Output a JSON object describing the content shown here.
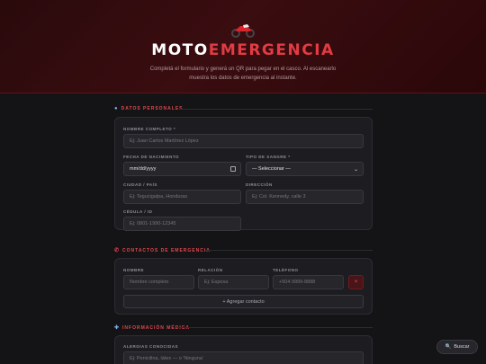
{
  "hero": {
    "icon": "motorcycle-icon",
    "title_white": "MOTO",
    "title_red": "EMERGENCIA",
    "subtitle": "Completá el formulario y generá un QR para pegar en el casco. Al escanearlo muestra los datos de emergencia al instante."
  },
  "sections": {
    "personal": {
      "icon": "person-icon",
      "label": "DATOS PERSONALES"
    },
    "contacts": {
      "icon": "phone-icon",
      "label": "CONTACTOS DE EMERGENCIA"
    },
    "medical": {
      "icon": "medical-icon",
      "label": "INFORMACIÓN MÉDICA"
    }
  },
  "personal": {
    "name_label": "NOMBRE COMPLETO *",
    "name_placeholder": "Ej: Juan Carlos Martínez López",
    "dob_label": "FECHA DE NACIMIENTO",
    "dob_value": "mm/dd/yyyy",
    "blood_label": "TIPO DE SANGRE *",
    "blood_value": "— Seleccionar —",
    "city_label": "CIUDAD / PAÍS",
    "city_placeholder": "Ej: Tegucigalpa, Honduras",
    "address_label": "DIRECCIÓN",
    "address_placeholder": "Ej: Col. Kennedy, calle 3",
    "id_label": "CÉDULA / ID",
    "id_placeholder": "Ej: 0801-1990-12345"
  },
  "contacts": {
    "col_name": "NOMBRE",
    "col_relation": "RELACIÓN",
    "col_phone": "TELÉFONO",
    "row": {
      "name_placeholder": "Nombre completo",
      "relation_placeholder": "Ej: Esposa",
      "phone_placeholder": "+504 9999-8888",
      "remove_label": "×"
    },
    "add_label": "+ Agregar contacto"
  },
  "medical": {
    "allergies_label": "ALERGIAS CONOCIDAS",
    "allergies_placeholder": "Ej: Penicilina, látex — o 'Ninguna'"
  },
  "fab": {
    "icon": "search-icon",
    "label": "Buscar"
  },
  "colors": {
    "accent": "#e23b43",
    "background": "#141416",
    "card": "#1d1d21"
  }
}
